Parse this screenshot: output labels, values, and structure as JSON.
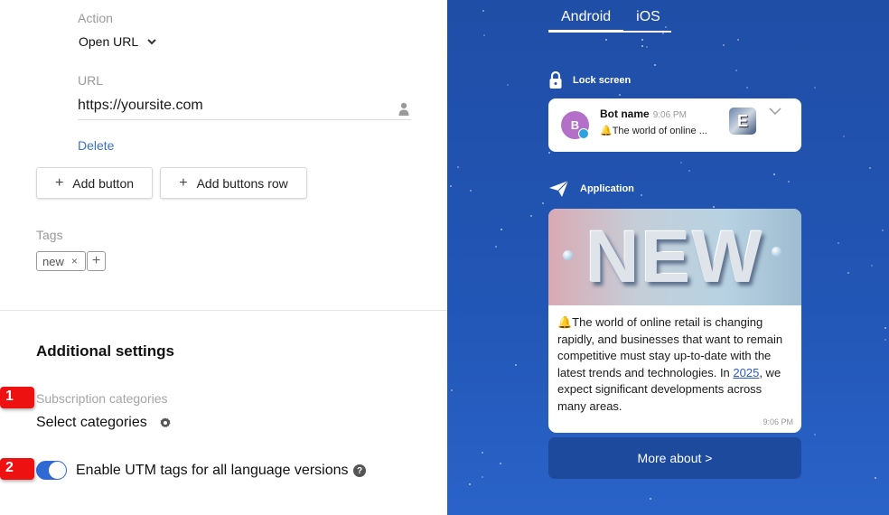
{
  "editor": {
    "action_label": "Action",
    "action_value": "Open URL",
    "url_label": "URL",
    "url_value": "https://yoursite.com",
    "delete_label": "Delete",
    "add_button_label": "Add button",
    "add_buttons_row_label": "Add buttons row",
    "tags_label": "Tags",
    "tags": [
      "new"
    ],
    "tag_remove_glyph": "×",
    "tag_add_glyph": "+",
    "plus_glyph": "+"
  },
  "additional": {
    "title": "Additional settings",
    "subscription_label": "Subscription categories",
    "select_categories": "Select categories",
    "utm_label": "Enable UTM tags for all language versions",
    "utm_enabled": true,
    "help_glyph": "?"
  },
  "markers": [
    "1",
    "2"
  ],
  "preview": {
    "tabs": [
      {
        "label": "Android",
        "active": true
      },
      {
        "label": "iOS",
        "active": false
      }
    ],
    "lock_screen_label": "Lock screen",
    "application_label": "Application",
    "notification": {
      "avatar_letter": "B",
      "bot_name": "Bot name",
      "time": "9:06 PM",
      "text": "🔔The world of online ...",
      "thumb_text": "E"
    },
    "message": {
      "image_text": "NEW",
      "text_before_link": "🔔The world of online retail is changing rapidly, and businesses that want to remain competitive must stay up-to-date with the latest trends and technologies. In ",
      "link_text": "2025",
      "text_after_link": ", we expect significant developments across many areas.",
      "time": "9:06 PM"
    },
    "button_label": "More about >"
  },
  "colors": {
    "accent_blue": "#3069d4",
    "link_blue": "#3d6fc4",
    "marker_red": "#ee1111",
    "preview_bg": "#2256b6"
  }
}
